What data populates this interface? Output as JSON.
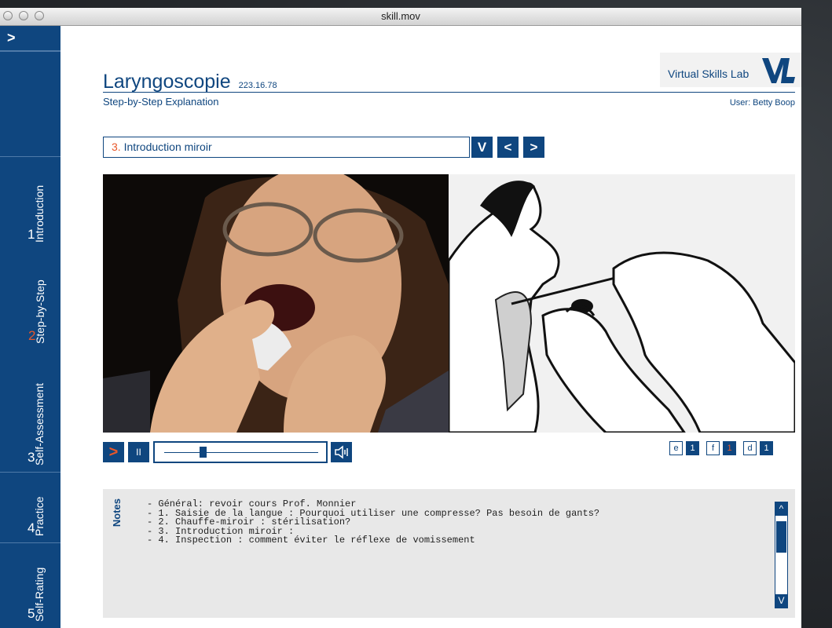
{
  "window": {
    "title": "skill.mov"
  },
  "sidebar": {
    "toggle_label": ">",
    "tabs": [
      {
        "number": "1",
        "label": "Introduction"
      },
      {
        "number": "2",
        "label": "Step-by-Step"
      },
      {
        "number": "3",
        "label": "Self-Assessment"
      },
      {
        "number": "4",
        "label": "Practice"
      },
      {
        "number": "5",
        "label": "Self-Rating"
      }
    ],
    "active_index": 1
  },
  "header": {
    "title": "Laryngoscopie",
    "code": "223.16.78",
    "brand": "Virtual Skills Lab",
    "subtitle": "Step-by-Step Explanation",
    "user": "User: Betty Boop"
  },
  "step_selector": {
    "number": "3.",
    "label": "Introduction miroir",
    "dropdown_label": "V",
    "prev_label": "<",
    "next_label": ">"
  },
  "player": {
    "play_label": ">",
    "pause_label": "II",
    "progress": 0.24
  },
  "languages": [
    {
      "code": "e",
      "level": "1"
    },
    {
      "code": "f",
      "level": "1"
    },
    {
      "code": "d",
      "level": "1"
    }
  ],
  "notes": {
    "label": "Notes",
    "lines": [
      "- Général: revoir cours Prof. Monnier",
      "- 1. Saisie de la langue : Pourquoi utiliser une compresse? Pas besoin de gants?",
      "- 2. Chauffe-miroir : stérilisation?",
      "- 3. Introduction miroir :",
      "- 4. Inspection : comment éviter le réflexe de vomissement"
    ],
    "scroll_up": "^",
    "scroll_down": "V"
  },
  "colors": {
    "brand": "#0f467f",
    "accent": "#e8572a"
  }
}
